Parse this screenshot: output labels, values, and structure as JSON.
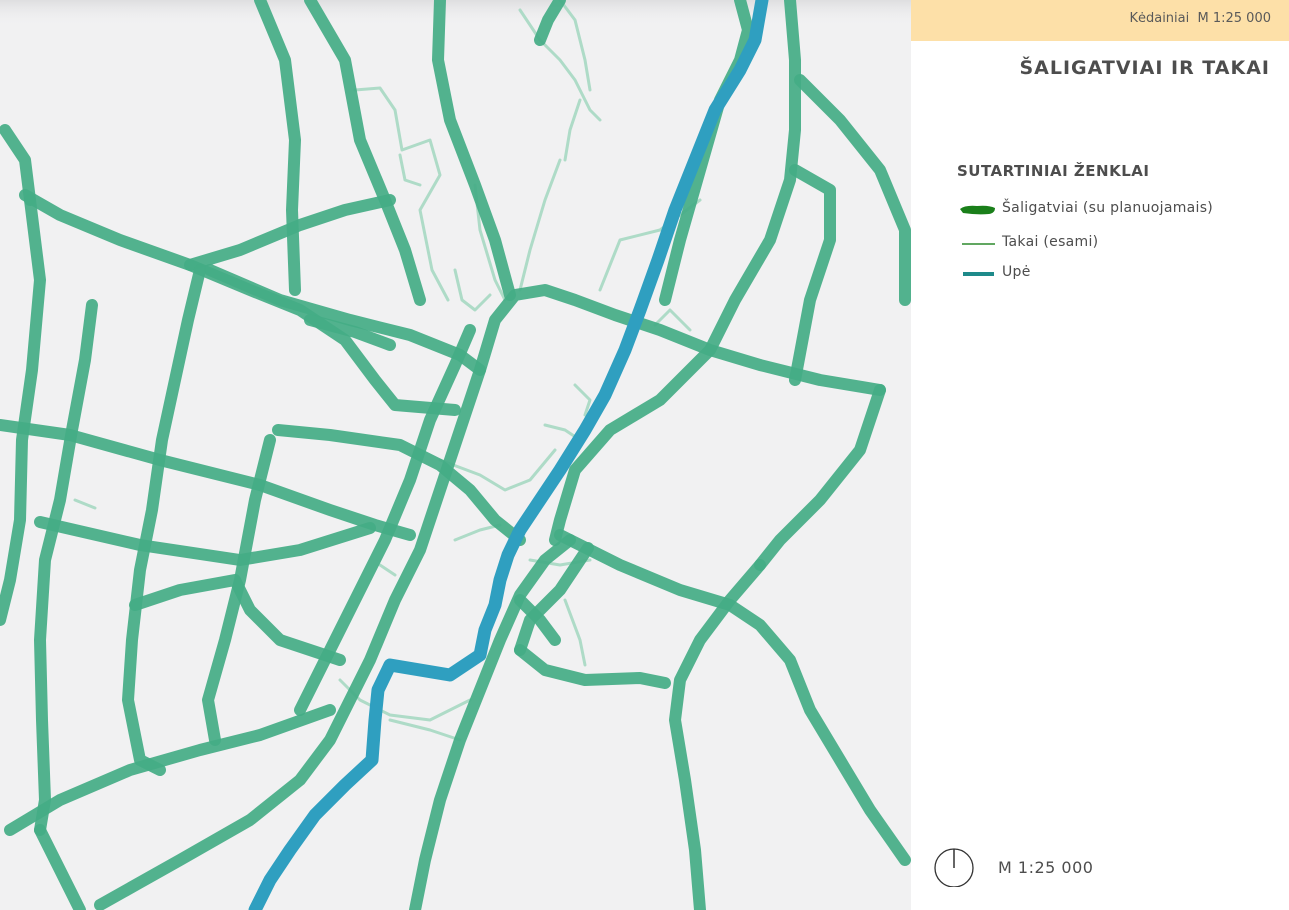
{
  "header": {
    "text": "Kėdainiai  M 1:25 000"
  },
  "title": "ŠALIGATVIAI IR TAKAI",
  "legend": {
    "title": "SUTARTINIAI ŽENKLAI",
    "items": [
      {
        "label": "Šaligatviai (su planuojamais)",
        "color": "#1a7f1a",
        "kind": "thick"
      },
      {
        "label": "Takai (esami)",
        "color": "#2d8a2d",
        "kind": "thin"
      },
      {
        "label": "Upė",
        "color": "#1e8a8a",
        "kind": "river"
      }
    ]
  },
  "scale": {
    "text": "M 1:25 000"
  },
  "colors": {
    "paper": "#f1f1f2",
    "sidewalk": "#3fae85",
    "sidewalk_edge": "#2b9a6f",
    "path": "#9fd4bd",
    "river": "#2e9bbd"
  }
}
